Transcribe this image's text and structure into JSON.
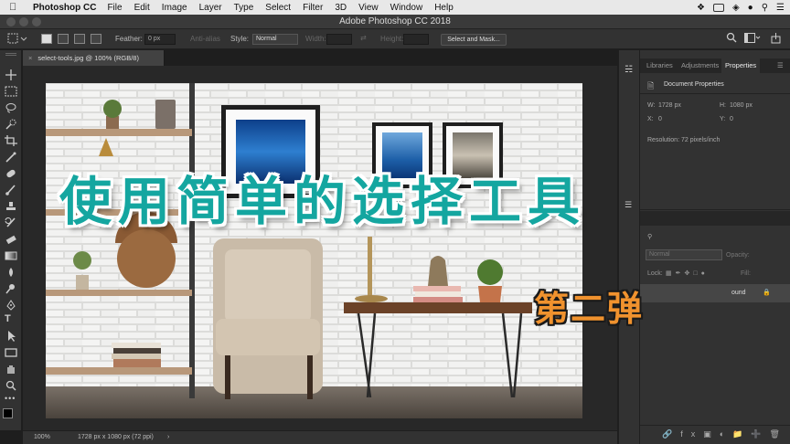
{
  "menubar": {
    "app_name": "Photoshop CC",
    "items": [
      "File",
      "Edit",
      "Image",
      "Layer",
      "Type",
      "Select",
      "Filter",
      "3D",
      "View",
      "Window",
      "Help"
    ]
  },
  "window": {
    "title": "Adobe Photoshop CC 2018"
  },
  "options_bar": {
    "feather_label": "Feather:",
    "feather_value": "0 px",
    "antialias_label": "Anti-alias",
    "style_label": "Style:",
    "style_value": "Normal",
    "width_label": "Width:",
    "height_label": "Height:",
    "select_mask_label": "Select and Mask..."
  },
  "document": {
    "tab_label": "select-tools.jpg @ 100% (RGB/8)",
    "zoom": "100%",
    "info": "1728 px x 1080 px (72 ppi)"
  },
  "panel": {
    "tabs": [
      "Libraries",
      "Adjustments",
      "Properties"
    ],
    "active_tab": "Properties",
    "section_title": "Document Properties",
    "w_label": "W:",
    "w_value": "1728 px",
    "h_label": "H:",
    "h_value": "1080 px",
    "x_label": "X:",
    "x_value": "0",
    "y_label": "Y:",
    "y_value": "0",
    "resolution": "Resolution: 72 pixels/inch",
    "layers": {
      "blend_mode": "Normal",
      "opacity_label": "Opacity:",
      "lock_label": "Lock:",
      "fill_label": "Fill:",
      "layer_name": "ound"
    }
  },
  "overlay": {
    "headline": "使用简单的选择工具",
    "subhead": "第二弹",
    "headline_color": "#14a6a0",
    "subhead_color": "#f0922e"
  }
}
